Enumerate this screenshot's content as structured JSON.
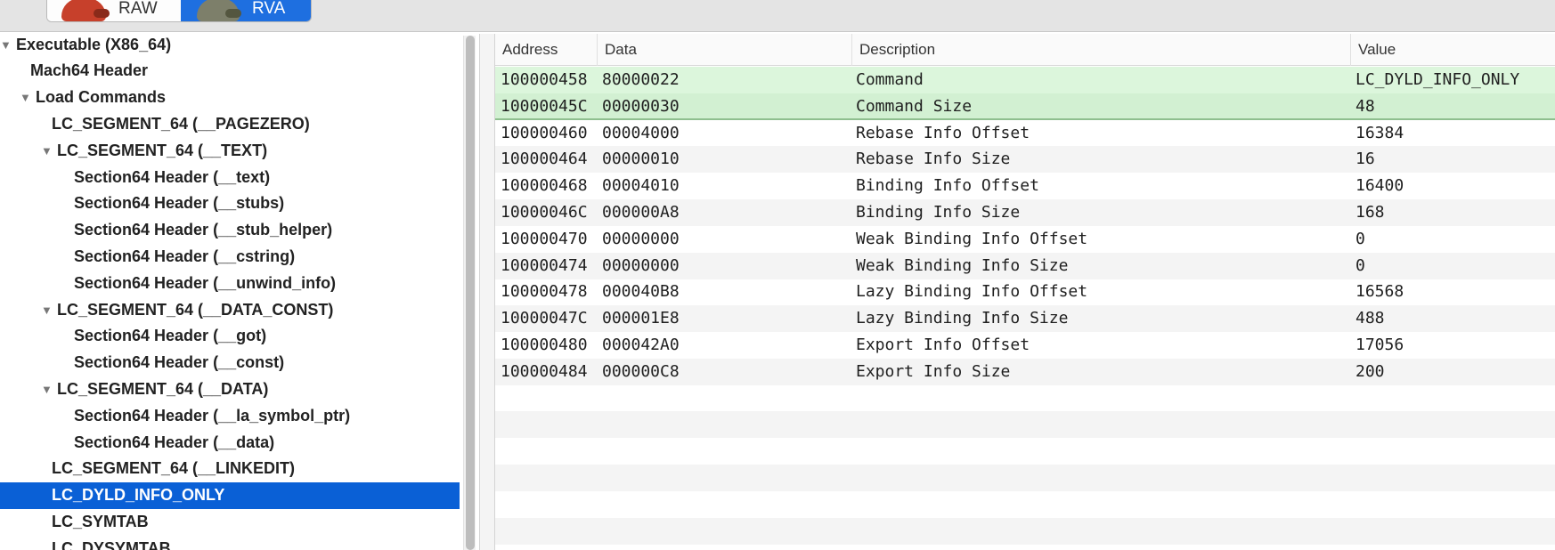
{
  "toolbar": {
    "raw_label": "RAW",
    "rva_label": "RVA",
    "raw_icon": "raw-mode-icon",
    "rva_icon": "rva-mode-icon",
    "active": "RVA"
  },
  "tree": {
    "items": [
      {
        "label": "Executable  (X86_64)",
        "level": 0,
        "expanded": true
      },
      {
        "label": "Mach64 Header",
        "level": 1
      },
      {
        "label": "Load Commands",
        "level": 1,
        "expanded": true
      },
      {
        "label": "LC_SEGMENT_64 (__PAGEZERO)",
        "level": 2
      },
      {
        "label": "LC_SEGMENT_64 (__TEXT)",
        "level": 2,
        "expanded": true
      },
      {
        "label": "Section64 Header (__text)",
        "level": 3
      },
      {
        "label": "Section64 Header (__stubs)",
        "level": 3
      },
      {
        "label": "Section64 Header (__stub_helper)",
        "level": 3
      },
      {
        "label": "Section64 Header (__cstring)",
        "level": 3
      },
      {
        "label": "Section64 Header (__unwind_info)",
        "level": 3
      },
      {
        "label": "LC_SEGMENT_64 (__DATA_CONST)",
        "level": 2,
        "expanded": true
      },
      {
        "label": "Section64 Header (__got)",
        "level": 3
      },
      {
        "label": "Section64 Header (__const)",
        "level": 3
      },
      {
        "label": "LC_SEGMENT_64 (__DATA)",
        "level": 2,
        "expanded": true
      },
      {
        "label": "Section64 Header (__la_symbol_ptr)",
        "level": 3
      },
      {
        "label": "Section64 Header (__data)",
        "level": 3
      },
      {
        "label": "LC_SEGMENT_64 (__LINKEDIT)",
        "level": 2
      },
      {
        "label": "LC_DYLD_INFO_ONLY",
        "level": 2,
        "selected": true
      },
      {
        "label": "LC_SYMTAB",
        "level": 2
      },
      {
        "label": "LC_DYSYMTAB",
        "level": 2
      }
    ]
  },
  "table": {
    "columns": [
      "Address",
      "Data",
      "Description",
      "Value"
    ],
    "rows": [
      {
        "address": "100000458",
        "data": "80000022",
        "description": "Command",
        "value": "LC_DYLD_INFO_ONLY",
        "highlight": true
      },
      {
        "address": "10000045C",
        "data": "00000030",
        "description": "Command Size",
        "value": "48",
        "highlight": true
      },
      {
        "address": "100000460",
        "data": "00004000",
        "description": "Rebase Info Offset",
        "value": "16384"
      },
      {
        "address": "100000464",
        "data": "00000010",
        "description": "Rebase Info Size",
        "value": "16"
      },
      {
        "address": "100000468",
        "data": "00004010",
        "description": "Binding Info Offset",
        "value": "16400"
      },
      {
        "address": "10000046C",
        "data": "000000A8",
        "description": "Binding Info Size",
        "value": "168"
      },
      {
        "address": "100000470",
        "data": "00000000",
        "description": "Weak Binding Info Offset",
        "value": "0"
      },
      {
        "address": "100000474",
        "data": "00000000",
        "description": "Weak Binding Info Size",
        "value": "0"
      },
      {
        "address": "100000478",
        "data": "000040B8",
        "description": "Lazy Binding Info Offset",
        "value": "16568"
      },
      {
        "address": "10000047C",
        "data": "000001E8",
        "description": "Lazy Binding Info Size",
        "value": "488"
      },
      {
        "address": "100000480",
        "data": "000042A0",
        "description": "Export Info Offset",
        "value": "17056"
      },
      {
        "address": "100000484",
        "data": "000000C8",
        "description": "Export Info Size",
        "value": "200"
      }
    ]
  },
  "colors": {
    "selection": "#0a60d6",
    "highlight_row": "#dcf6dc",
    "segmented_active": "#1e6fe0"
  }
}
